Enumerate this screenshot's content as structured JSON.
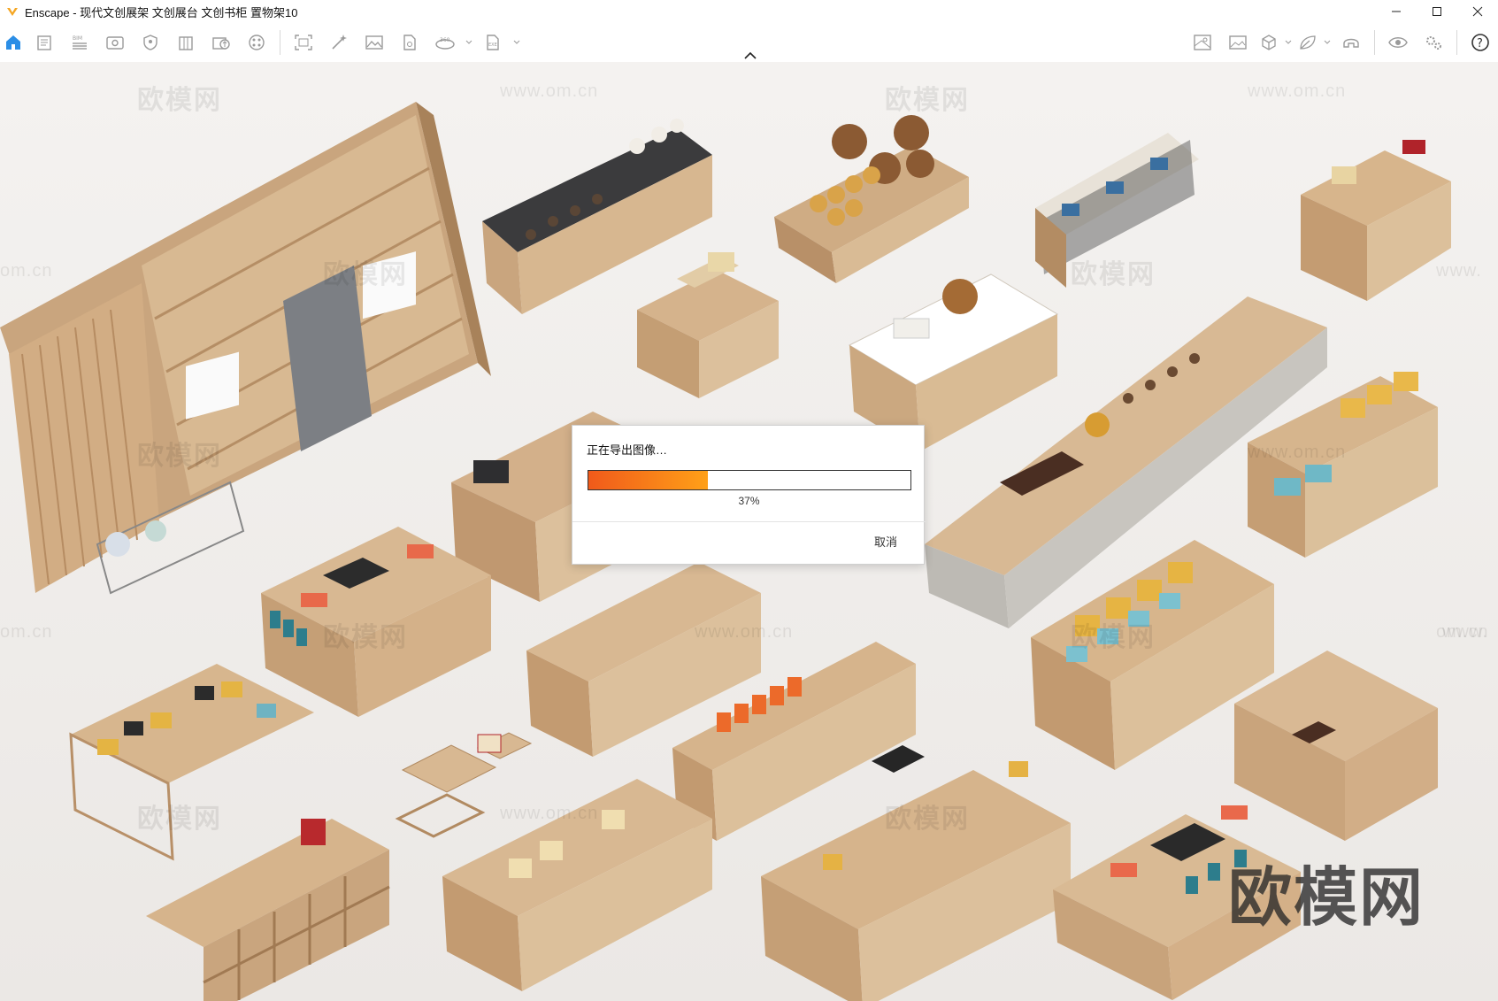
{
  "window": {
    "app_name": "Enscape",
    "title": "Enscape - 现代文创展架 文创展台 文创书柜 置物架10",
    "accent_color": "#f5a623"
  },
  "toolbar": {
    "left_icons": [
      "home-icon",
      "document-icon",
      "bim-icon",
      "view-icon",
      "shield-icon",
      "building-icon",
      "upload-icon",
      "palette-icon",
      "screenshot-icon",
      "magic-wand-icon",
      "image-icon",
      "file-icon",
      "panorama-360-icon",
      "export-icon"
    ],
    "right_icons": [
      "map-icon",
      "landscape-icon",
      "cube-icon",
      "leaf-icon",
      "headset-icon",
      "eye-icon",
      "settings-icon",
      "help-icon"
    ]
  },
  "viewport": {
    "watermarks": [
      "欧模网",
      "www.om.cn",
      "欧模网",
      "www.om.cn",
      "om.cn",
      "欧模网",
      "www.",
      "欧模网",
      "om.cn",
      "欧模网",
      "www.om.cn",
      "欧模网",
      "www.om.cn",
      "om.cn",
      "欧模网",
      "www.",
      "欧模网",
      "www.om.cn",
      "欧模网"
    ],
    "brand_watermark": "欧模网"
  },
  "dialog": {
    "title": "正在导出图像…",
    "progress_value": 0.37,
    "progress_text": "37%",
    "cancel_label": "取消",
    "progress_start_color": "#f05a1a",
    "progress_end_color": "#ffa018"
  }
}
